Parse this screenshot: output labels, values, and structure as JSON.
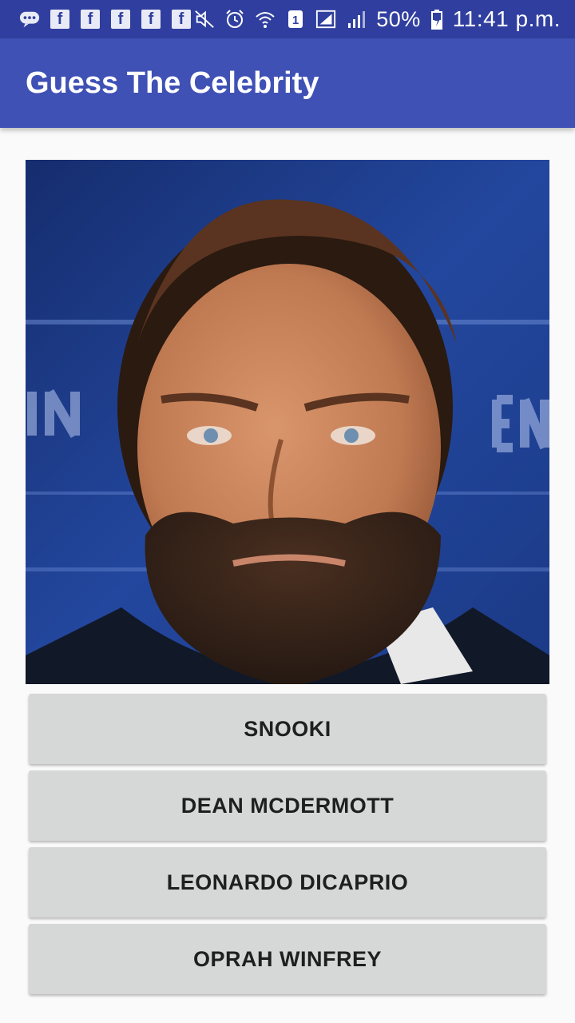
{
  "status_bar": {
    "icons": [
      "chat-icon",
      "facebook-icon",
      "facebook-icon",
      "facebook-icon",
      "facebook-icon",
      "facebook-icon",
      "mute-icon",
      "alarm-icon",
      "wifi-icon",
      "sim-1-icon",
      "signal-icon",
      "signal-icon",
      "battery-icon"
    ],
    "battery": "50%",
    "time": "11:41 p.m."
  },
  "app_bar": {
    "title": "Guess The Celebrity",
    "color": "#3f51b5",
    "status_color": "#303f9f"
  },
  "image": {
    "subject": "celebrity-photo"
  },
  "answers": [
    {
      "label": "SNOOKI"
    },
    {
      "label": "DEAN MCDERMOTT"
    },
    {
      "label": "LEONARDO DICAPRIO"
    },
    {
      "label": "OPRAH WINFREY"
    }
  ]
}
